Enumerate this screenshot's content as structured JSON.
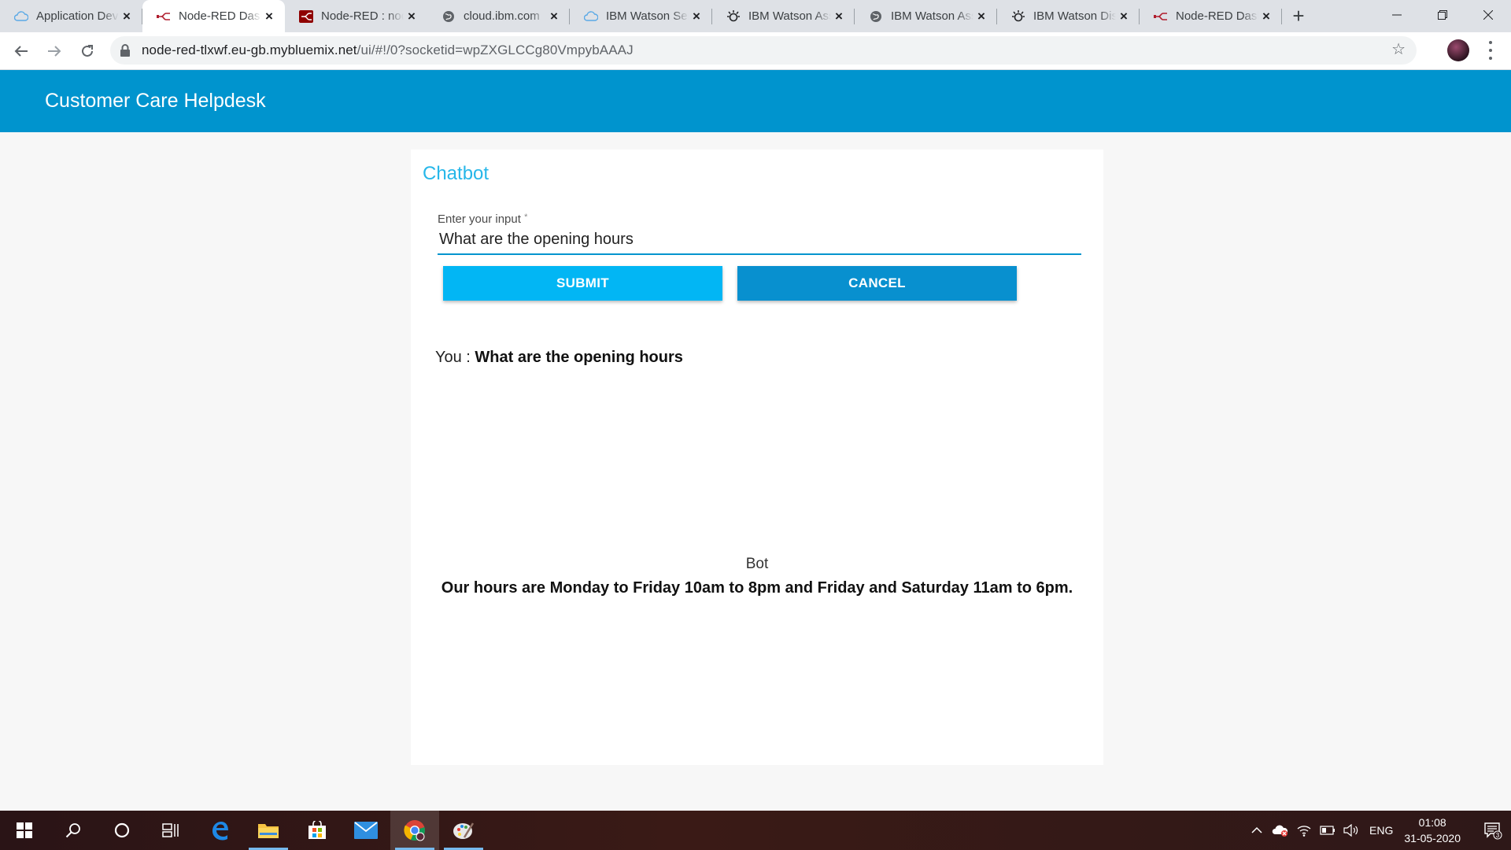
{
  "browser": {
    "tabs": [
      {
        "title": "Application Development",
        "icon": "cloud-icon"
      },
      {
        "title": "Node-RED Dashboard",
        "icon": "node-red-icon",
        "active": true
      },
      {
        "title": "Node-RED : node-red",
        "icon": "node-red-red-icon"
      },
      {
        "title": "cloud.ibm.com",
        "icon": "globe-icon"
      },
      {
        "title": "IBM Watson Services",
        "icon": "cloud-icon"
      },
      {
        "title": "IBM Watson Assistant",
        "icon": "watson-icon"
      },
      {
        "title": "IBM Watson Assistant",
        "icon": "globe-icon"
      },
      {
        "title": "IBM Watson Discovery",
        "icon": "watson-icon"
      },
      {
        "title": "Node-RED Dashboard",
        "icon": "node-red-icon"
      }
    ],
    "url_host": "node-red-tlxwf.eu-gb.mybluemix.net",
    "url_rest": "/ui/#!/0?socketid=wpZXGLCCg80VmpybAAAJ"
  },
  "app": {
    "title": "Customer Care Helpdesk"
  },
  "chatbot": {
    "title": "Chatbot",
    "input_label": "Enter your input",
    "input_required_mark": "*",
    "input_value": "What are the opening hours",
    "submit_label": "SUBMIT",
    "cancel_label": "CANCEL",
    "you_prefix": "You : ",
    "you_message": "What are the opening hours",
    "bot_label": "Bot",
    "bot_message": "Our hours are Monday to Friday 10am to 8pm and Friday and Saturday 11am to 6pm."
  },
  "taskbar": {
    "language": "ENG",
    "time": "01:08",
    "date": "31-05-2020",
    "notification_count": "3"
  },
  "colors": {
    "header": "#0094ce",
    "title_accent": "#26b7e9",
    "submit": "#02b6f4",
    "cancel": "#0890cf"
  }
}
